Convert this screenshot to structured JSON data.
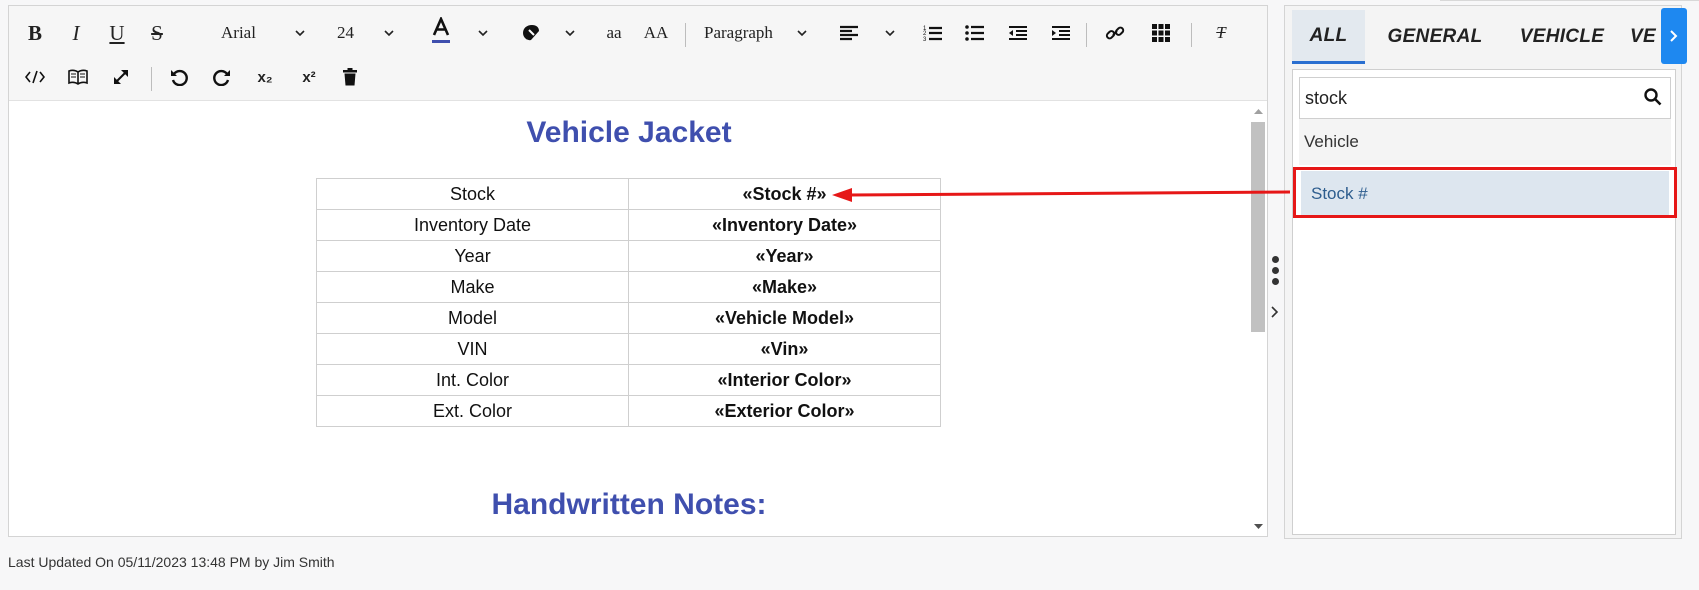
{
  "toolbar": {
    "font_family": "Arial",
    "font_size": "24",
    "lowercase_label": "aa",
    "uppercase_label": "AA",
    "block_format": "Paragraph",
    "bold": "B",
    "italic": "I",
    "underline": "U",
    "strikethrough": "S",
    "subscript": "x₂",
    "superscript": "x²",
    "clear_format": "T"
  },
  "document": {
    "title": "Vehicle Jacket",
    "table": [
      {
        "label": "Stock",
        "value": "«Stock #»"
      },
      {
        "label": "Inventory Date",
        "value": "«Inventory Date»"
      },
      {
        "label": "Year",
        "value": "«Year»"
      },
      {
        "label": "Make",
        "value": "«Make»"
      },
      {
        "label": "Model",
        "value": "«Vehicle Model»"
      },
      {
        "label": "VIN",
        "value": "«Vin»"
      },
      {
        "label": "Int. Color",
        "value": "«Interior Color»"
      },
      {
        "label": "Ext. Color",
        "value": "«Exterior Color»"
      }
    ],
    "subtitle": "Handwritten Notes:"
  },
  "panel": {
    "tabs": [
      "ALL",
      "GENERAL",
      "VEHICLE",
      "VE"
    ],
    "active_tab": "ALL",
    "search_value": "stock",
    "group_header": "Vehicle",
    "results": [
      "Stock #"
    ]
  },
  "footer": {
    "text": "Last Updated On 05/11/2023 13:48 PM by Jim Smith"
  },
  "colors": {
    "title": "#3f4fae",
    "highlight_border": "#e61717",
    "active_tab_underline": "#2a6fd0",
    "tab_scroll_button": "#1e88f0",
    "result_row_bg": "#dde6ef"
  }
}
